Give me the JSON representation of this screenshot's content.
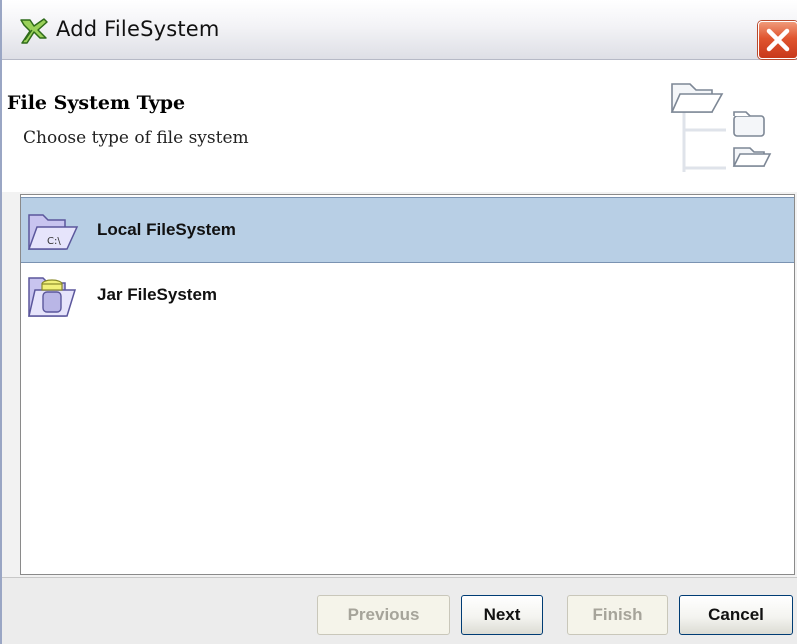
{
  "window": {
    "title": "Add FileSystem",
    "app_icon": "filesystem-wizard-icon",
    "close_icon": "close-icon"
  },
  "header": {
    "title": "File System Type",
    "subtitle": "Choose type of file system",
    "icon": "folder-tree-icon"
  },
  "list": {
    "items": [
      {
        "label": "Local FileSystem",
        "icon": "local-drive-folder-icon",
        "icon_text": "C:\\",
        "selected": true
      },
      {
        "label": "Jar FileSystem",
        "icon": "jar-folder-icon",
        "selected": false
      }
    ]
  },
  "footer": {
    "previous_label": "Previous",
    "next_label": "Next",
    "finish_label": "Finish",
    "cancel_label": "Cancel",
    "previous_enabled": false,
    "next_enabled": true,
    "finish_enabled": false,
    "cancel_enabled": true
  },
  "colors": {
    "selection": "#b8cfe5",
    "close_button": "#e0552f",
    "button_border": "#003c74"
  }
}
